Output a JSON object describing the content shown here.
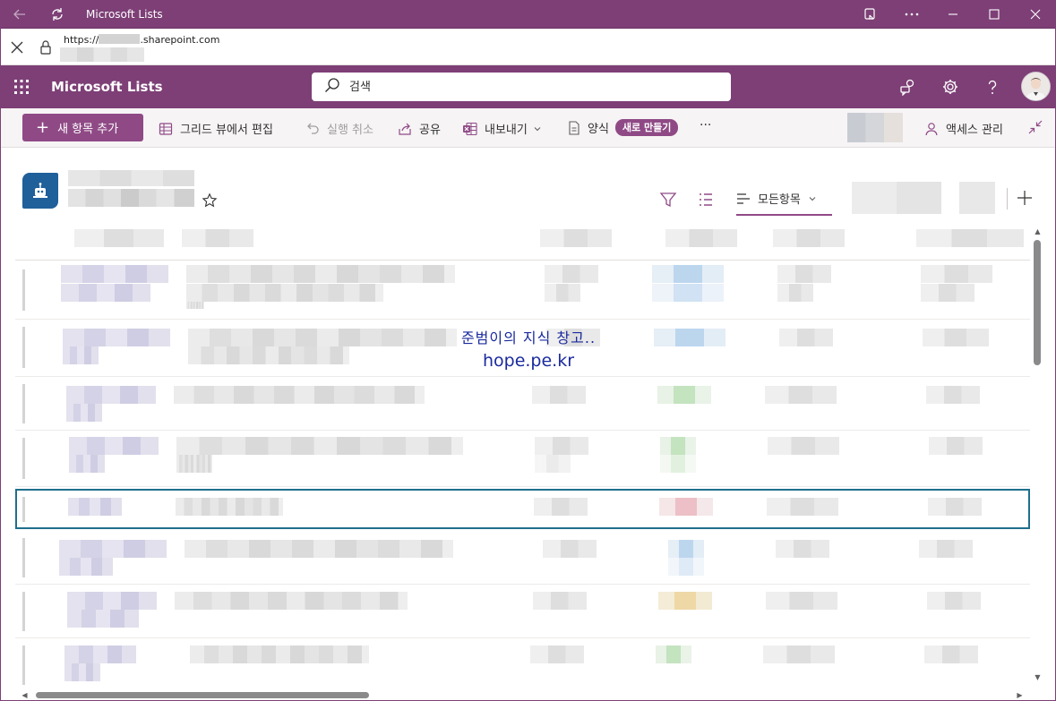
{
  "window": {
    "title": "Microsoft Lists"
  },
  "address_bar": {
    "url_prefix": "https://",
    "url_suffix": ".sharepoint.com"
  },
  "suite_bar": {
    "app_name": "Microsoft Lists",
    "search_placeholder": "검색"
  },
  "command_bar": {
    "new_item": "새 항목 추가",
    "grid_edit": "그리드 뷰에서 편집",
    "undo": "실행 취소",
    "share": "공유",
    "export": "내보내기",
    "form": "양식",
    "form_new_badge": "새로 만들기",
    "more": "···",
    "manage_access": "액세스 관리"
  },
  "views": {
    "active_view": "모든항목"
  },
  "watermark": {
    "line1": "준범이의 지식 창고..",
    "line2": "hope.pe.kr"
  },
  "colors": {
    "brand": "#7d3f76",
    "accent": "#8f4a86",
    "selection": "#1f6e8c",
    "list_icon": "#1f5f9a"
  },
  "icons": {
    "titlebar": [
      "back-arrow-icon",
      "reload-icon",
      "app-menu-icon",
      "more-icon",
      "minimize-icon",
      "maximize-icon",
      "close-icon"
    ],
    "address_bar": [
      "close-icon",
      "lock-icon"
    ],
    "suite_bar": [
      "waffle-icon",
      "search-icon",
      "chat-icon",
      "gear-icon",
      "help-icon"
    ],
    "command_bar": [
      "plus-icon",
      "grid-icon",
      "undo-icon",
      "share-icon",
      "excel-icon",
      "form-icon",
      "person-icon",
      "collapse-icon"
    ],
    "list_header": [
      "list-robot-icon",
      "star-icon",
      "filter-icon",
      "list-options-icon",
      "view-lines-icon",
      "chevron-down-icon",
      "plus-icon"
    ]
  }
}
